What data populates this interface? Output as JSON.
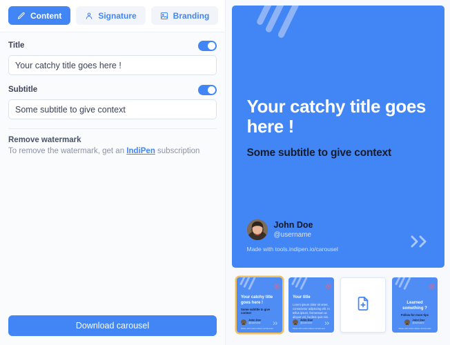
{
  "colors": {
    "accent": "#4285f4",
    "tab_inactive_bg": "#f1f4f9",
    "slide_bg": "#4285f4",
    "panel_bg": "#f7f9fc",
    "selected_thumb_border": "#f0c060"
  },
  "tabs": [
    {
      "label": "Content",
      "icon": "pencil-icon",
      "active": true
    },
    {
      "label": "Signature",
      "icon": "person-icon",
      "active": false
    },
    {
      "label": "Branding",
      "icon": "image-icon",
      "active": false
    }
  ],
  "form": {
    "title_field": {
      "label": "Title",
      "value": "Your catchy title goes here !",
      "placeholder": "Your catchy title goes here !",
      "toggle_on": true
    },
    "subtitle_field": {
      "label": "Subtitle",
      "value": "Some subtitle to give context",
      "placeholder": "Some subtitle to give context",
      "toggle_on": true
    }
  },
  "watermark": {
    "heading": "Remove watermark",
    "text_before": "To remove the watermark, get an ",
    "brand": "IndiPen",
    "text_after": " subscription"
  },
  "footer": {
    "download_label": "Download carousel"
  },
  "preview": {
    "title": "Your catchy title goes here !",
    "subtitle": "Some subtitle to give context",
    "author_name": "John Doe",
    "author_handle": "@username",
    "made_with": "Made with tools.indipen.io/carousel"
  },
  "thumbnails": [
    {
      "index": 1,
      "selected": true,
      "kind": "slide",
      "title": "Your catchy title goes here !",
      "subtitle": "Some subtitle to give context",
      "body": "",
      "author_name": "John Doe",
      "author_handle": "@username",
      "made_with": "Made with tools.indipen.io/carousel"
    },
    {
      "index": 2,
      "selected": false,
      "kind": "slide",
      "title": "Your title",
      "subtitle": "",
      "body": "Lorem ipsum dolor sit amet, consectetur adipiscing elit. In tellus ipsum, fermentum ac aliquet vel, facilisis quis nisi.",
      "author_name": "John Doe",
      "author_handle": "@username",
      "made_with": "Made with tools.indipen.io/carousel"
    },
    {
      "index": 3,
      "selected": false,
      "kind": "add",
      "icon": "file-plus-icon",
      "title": "",
      "subtitle": "",
      "body": "",
      "author_name": "",
      "author_handle": "",
      "made_with": ""
    },
    {
      "index": 4,
      "selected": false,
      "kind": "slide",
      "title": "Learned something ?",
      "subtitle": "Follow for more tips",
      "body": "",
      "author_name": "John Doe",
      "author_handle": "@username",
      "made_with": "Made with tools.indipen.io/carousel"
    }
  ]
}
